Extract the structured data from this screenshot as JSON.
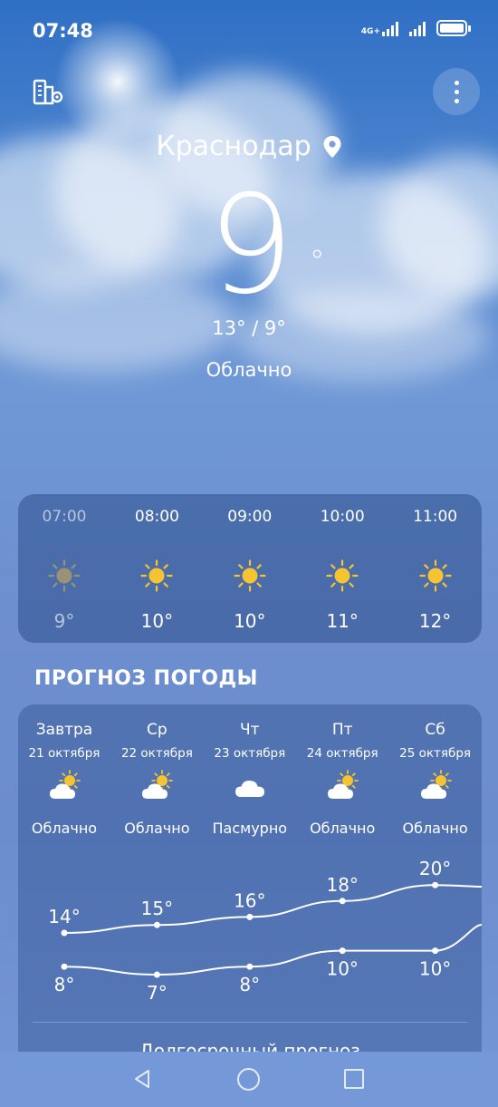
{
  "status_bar": {
    "time": "07:48",
    "network": "4G+",
    "icons": [
      "signal-4g-icon",
      "signal-icon",
      "battery-icon"
    ]
  },
  "header": {
    "city": "Краснодар",
    "left_icon": "city-manage-icon",
    "right_icon": "more-vertical-icon"
  },
  "current": {
    "temperature": "9",
    "degree": "°",
    "range": "13° / 9°",
    "condition": "Облачно"
  },
  "hourly": [
    {
      "time": "07:00",
      "temp": "9°",
      "icon": "sun-icon",
      "past": true
    },
    {
      "time": "08:00",
      "temp": "10°",
      "icon": "sun-icon",
      "past": false
    },
    {
      "time": "09:00",
      "temp": "10°",
      "icon": "sun-icon",
      "past": false
    },
    {
      "time": "10:00",
      "temp": "11°",
      "icon": "sun-icon",
      "past": false
    },
    {
      "time": "11:00",
      "temp": "12°",
      "icon": "sun-icon",
      "past": false
    }
  ],
  "forecast": {
    "title": "ПРОГНОЗ ПОГОДЫ",
    "days": [
      {
        "name": "Завтра",
        "date": "21 октября",
        "condition": "Облачно",
        "icon": "partly-cloudy-icon",
        "high": 14,
        "low": 8,
        "high_label": "14°",
        "low_label": "8°"
      },
      {
        "name": "Ср",
        "date": "22 октября",
        "condition": "Облачно",
        "icon": "partly-cloudy-icon",
        "high": 15,
        "low": 7,
        "high_label": "15°",
        "low_label": "7°"
      },
      {
        "name": "Чт",
        "date": "23 октября",
        "condition": "Пасмурно",
        "icon": "cloud-icon",
        "high": 16,
        "low": 8,
        "high_label": "16°",
        "low_label": "8°"
      },
      {
        "name": "Пт",
        "date": "24 октября",
        "condition": "Облачно",
        "icon": "partly-cloudy-icon",
        "high": 18,
        "low": 10,
        "high_label": "18°",
        "low_label": "10°"
      },
      {
        "name": "Сб",
        "date": "25 октября",
        "condition": "Облачно",
        "icon": "partly-cloudy-icon",
        "high": 20,
        "low": 10,
        "high_label": "20°",
        "low_label": "10°"
      }
    ],
    "long_range_link": "Долгосрочный прогноз"
  },
  "colors": {
    "sun_active": "#f6c431",
    "sun_past": "#9a9274",
    "accent_text": "#ffffff"
  },
  "nav_bar": {
    "icons": [
      "back-icon",
      "home-icon",
      "recent-apps-icon"
    ]
  }
}
